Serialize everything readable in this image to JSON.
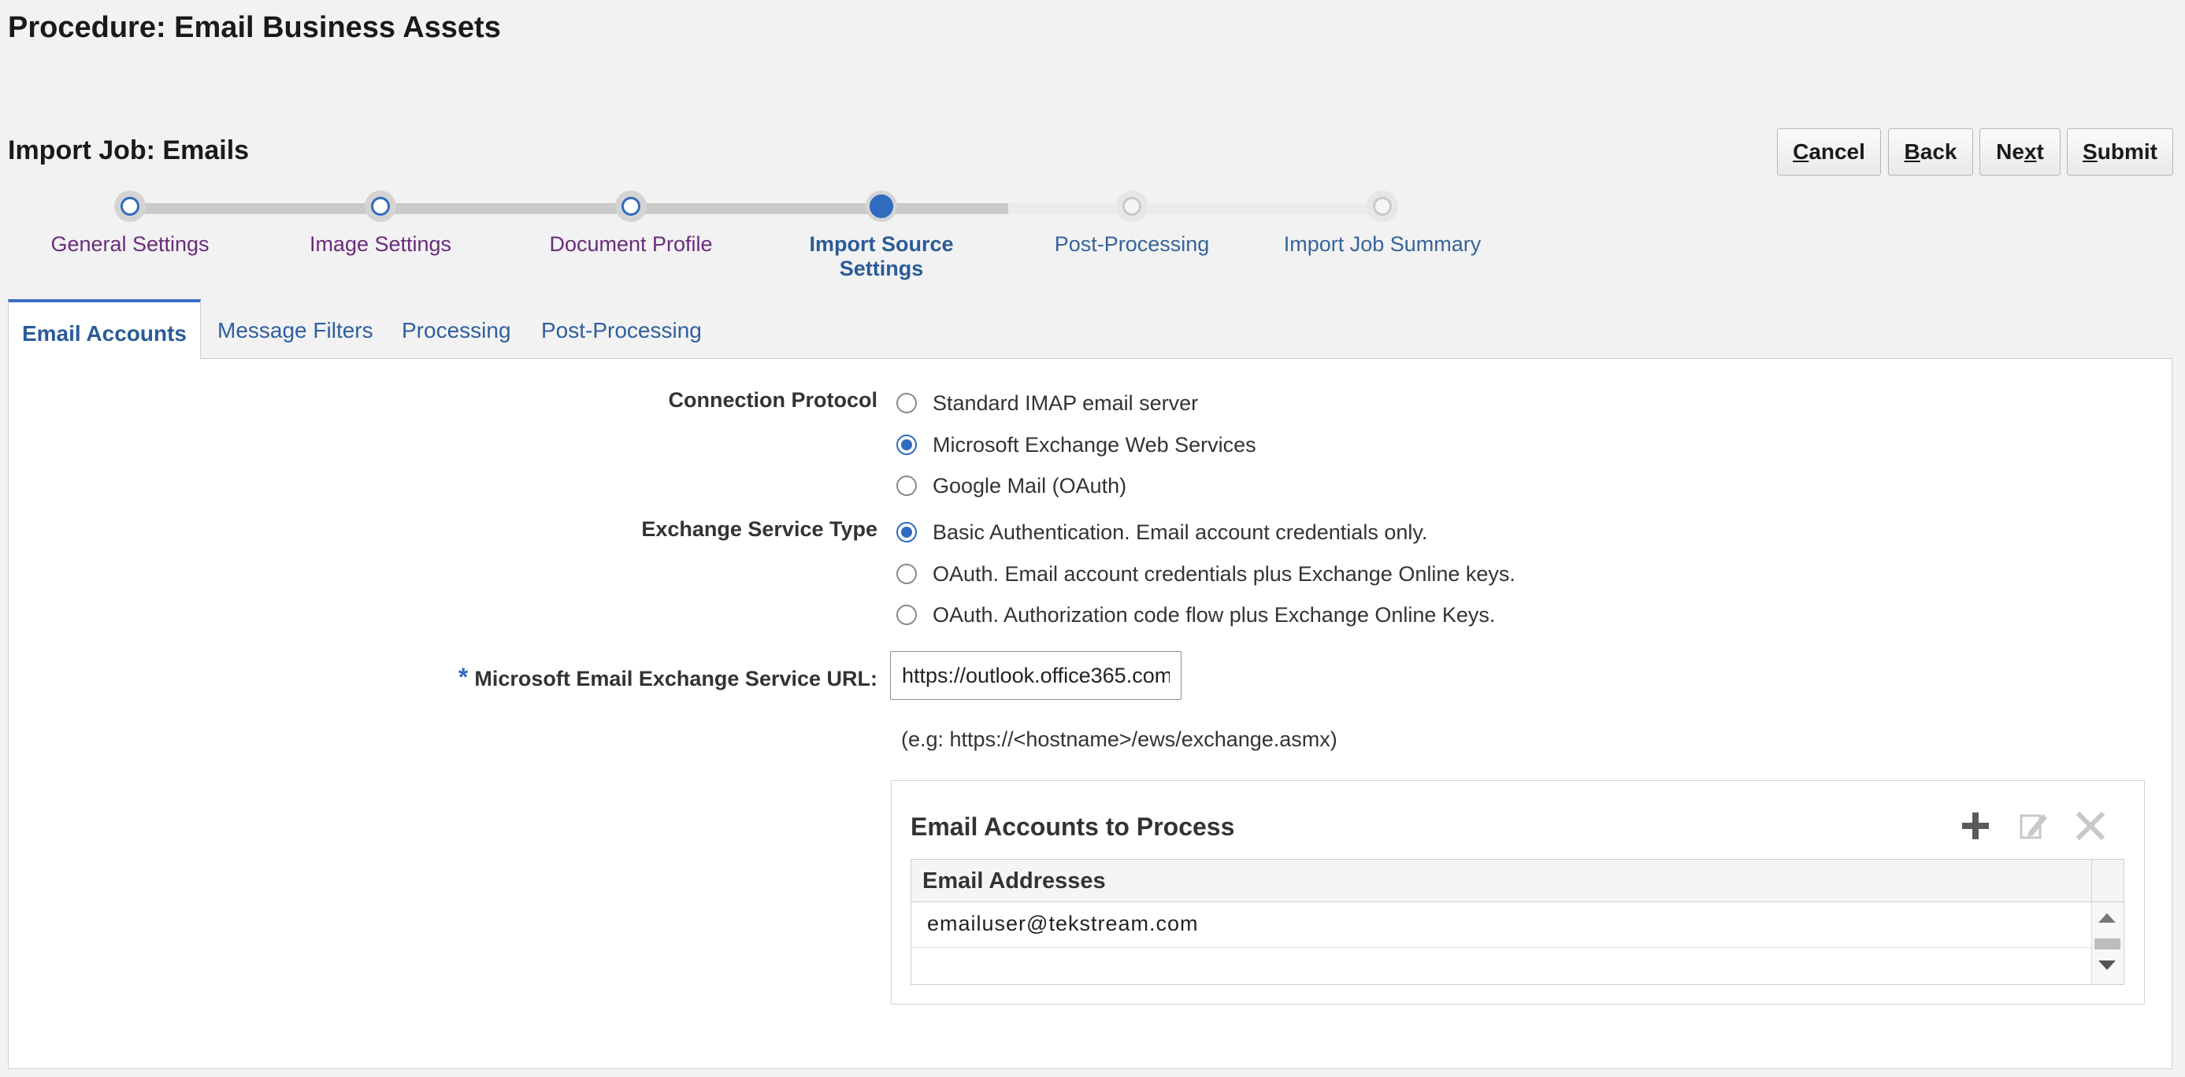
{
  "procedure": {
    "title": "Procedure: Email Business Assets"
  },
  "job": {
    "title": "Import Job: Emails"
  },
  "toolbar": {
    "cancel": {
      "pre": "",
      "key": "C",
      "post": "ancel"
    },
    "back": {
      "pre": "",
      "key": "B",
      "post": "ack"
    },
    "next": {
      "pre": "Ne",
      "key": "x",
      "post": "t"
    },
    "submit": {
      "pre": "",
      "key": "S",
      "post": "ubmit"
    }
  },
  "train": {
    "steps": [
      {
        "label": "General Settings",
        "state": "visited"
      },
      {
        "label": "Image Settings",
        "state": "visited"
      },
      {
        "label": "Document Profile",
        "state": "visited"
      },
      {
        "label": "Import Source Settings",
        "state": "current"
      },
      {
        "label": "Post-Processing",
        "state": "future"
      },
      {
        "label": "Import Job Summary",
        "state": "future"
      }
    ]
  },
  "tabs": [
    {
      "label": "Email Accounts",
      "selected": true
    },
    {
      "label": "Message Filters",
      "selected": false
    },
    {
      "label": "Processing",
      "selected": false
    },
    {
      "label": "Post-Processing",
      "selected": false
    }
  ],
  "form": {
    "connection_protocol": {
      "label": "Connection Protocol",
      "options": [
        {
          "label": "Standard IMAP email server",
          "checked": false
        },
        {
          "label": "Microsoft Exchange Web Services",
          "checked": true
        },
        {
          "label": "Google Mail (OAuth)",
          "checked": false
        }
      ]
    },
    "exchange_service_type": {
      "label": "Exchange Service Type",
      "options": [
        {
          "label": "Basic Authentication. Email account credentials only.",
          "checked": true
        },
        {
          "label": "OAuth. Email account credentials plus Exchange Online keys.",
          "checked": false
        },
        {
          "label": "OAuth. Authorization code flow plus Exchange Online Keys.",
          "checked": false
        }
      ]
    },
    "service_url": {
      "required_mark": "*",
      "label": "Microsoft Email Exchange Service URL:",
      "value": "https://outlook.office365.com",
      "hint": "(e.g: https://<hostname>/ews/exchange.asmx)"
    }
  },
  "accounts": {
    "title": "Email Accounts to Process",
    "column_header": "Email Addresses",
    "rows": [
      "emailuser@tekstream.com"
    ]
  },
  "colors": {
    "accent": "#2f6bbf",
    "visited_link": "#6a2b7e",
    "tab_text": "#2f5f9e"
  },
  "icons": [
    "plus-icon",
    "edit-icon",
    "delete-icon"
  ]
}
